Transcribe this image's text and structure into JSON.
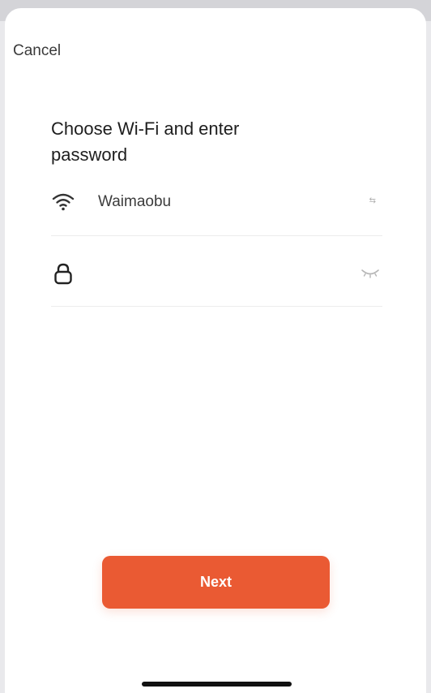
{
  "header": {
    "cancel_label": "Cancel"
  },
  "main": {
    "title": "Choose Wi-Fi and enter password",
    "wifi": {
      "ssid": "Waimaobu",
      "icon": "wifi-icon",
      "switch_label": "⇆"
    },
    "password": {
      "value": "",
      "icon": "lock-icon",
      "toggle_icon": "eye-closed-icon"
    },
    "next_label": "Next"
  },
  "colors": {
    "accent": "#ea5a33",
    "background": "#ffffff",
    "text": "#1e1e1e"
  }
}
